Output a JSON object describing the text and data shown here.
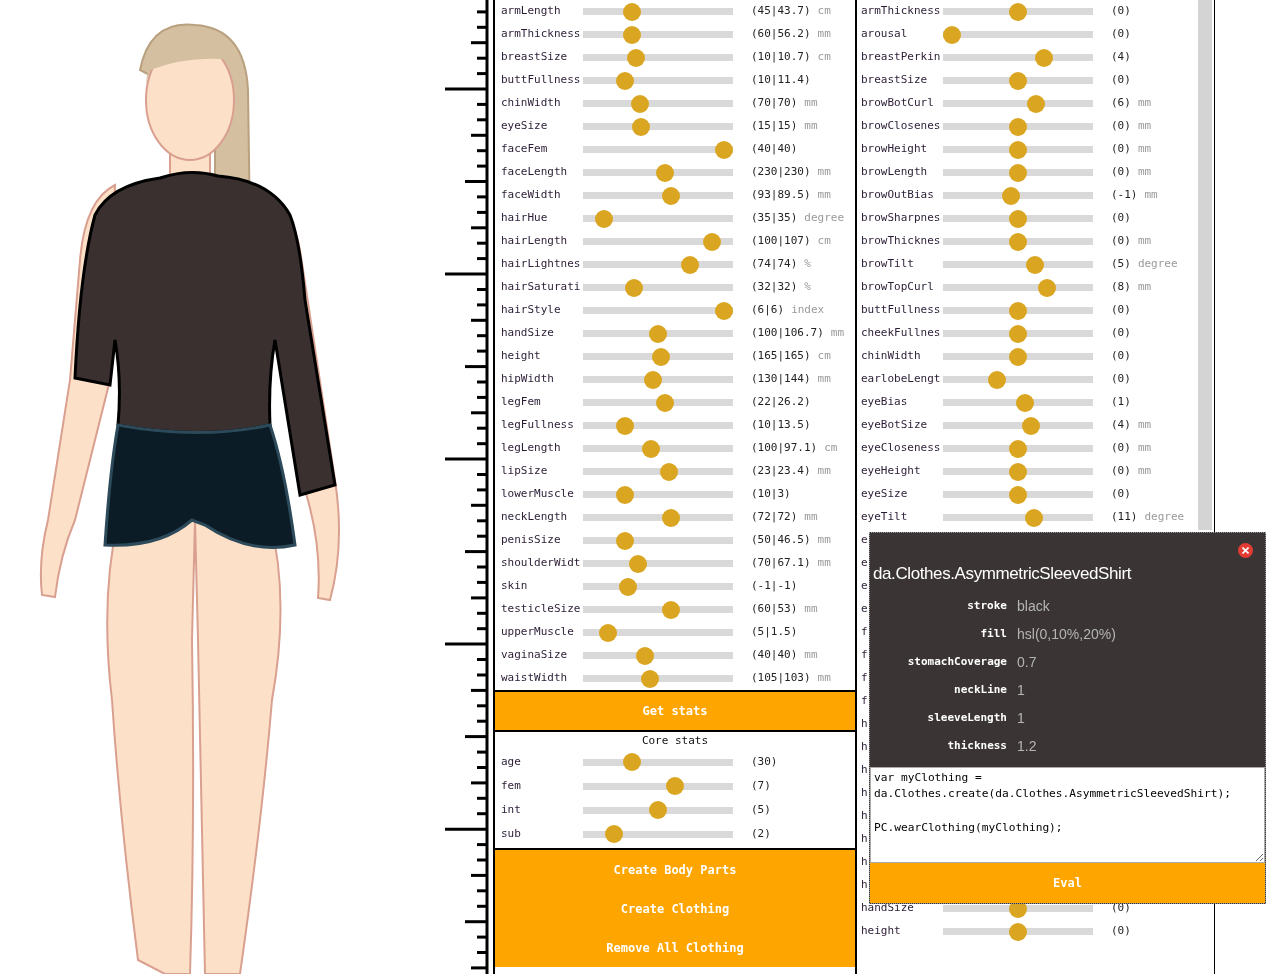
{
  "body_sliders": [
    {
      "label": "armLength",
      "level": 0.3,
      "value": "(45|43.7)",
      "unit": "cm"
    },
    {
      "label": "armThickness",
      "level": 0.3,
      "value": "(60|56.2)",
      "unit": "mm"
    },
    {
      "label": "breastSize",
      "level": 0.33,
      "value": "(10|10.7)",
      "unit": "cm"
    },
    {
      "label": "buttFullness",
      "level": 0.25,
      "value": "(10|11.4)"
    },
    {
      "label": "chinWidth",
      "level": 0.36,
      "value": "(70|70)",
      "unit": "mm"
    },
    {
      "label": "eyeSize",
      "level": 0.37,
      "value": "(15|15)",
      "unit": "mm"
    },
    {
      "label": "faceFem",
      "level": 1.0,
      "value": "(40|40)"
    },
    {
      "label": "faceLength",
      "level": 0.55,
      "value": "(230|230)",
      "unit": "mm"
    },
    {
      "label": "faceWidth",
      "level": 0.6,
      "value": "(93|89.5)",
      "unit": "mm"
    },
    {
      "label": "hairHue",
      "level": 0.09,
      "value": "(35|35)",
      "unit": "degree"
    },
    {
      "label": "hairLength",
      "level": 0.91,
      "value": "(100|107)",
      "unit": "cm"
    },
    {
      "label": "hairLightnes",
      "level": 0.74,
      "value": "(74|74)",
      "unit": "%"
    },
    {
      "label": "hairSaturati",
      "level": 0.32,
      "value": "(32|32)",
      "unit": "%"
    },
    {
      "label": "hairStyle",
      "level": 1.0,
      "value": "(6|6)",
      "unit": "index"
    },
    {
      "label": "handSize",
      "level": 0.5,
      "value": "(100|106.7)",
      "unit": "mm"
    },
    {
      "label": "height",
      "level": 0.52,
      "value": "(165|165)",
      "unit": "cm"
    },
    {
      "label": "hipWidth",
      "level": 0.46,
      "value": "(130|144)",
      "unit": "mm"
    },
    {
      "label": "legFem",
      "level": 0.55,
      "value": "(22|26.2)"
    },
    {
      "label": "legFullness",
      "level": 0.25,
      "value": "(10|13.5)"
    },
    {
      "label": "legLength",
      "level": 0.45,
      "value": "(100|97.1)",
      "unit": "cm"
    },
    {
      "label": "lipSize",
      "level": 0.58,
      "value": "(23|23.4)",
      "unit": "mm"
    },
    {
      "label": "lowerMuscle",
      "level": 0.25,
      "value": "(10|3)"
    },
    {
      "label": "neckLength",
      "level": 0.6,
      "value": "(72|72)",
      "unit": "mm"
    },
    {
      "label": "penisSize",
      "level": 0.25,
      "value": "(50|46.5)",
      "unit": "mm"
    },
    {
      "label": "shoulderWidt",
      "level": 0.35,
      "value": "(70|67.1)",
      "unit": "mm"
    },
    {
      "label": "skin",
      "level": 0.27,
      "value": "(-1|-1)"
    },
    {
      "label": "testicleSize",
      "level": 0.6,
      "value": "(60|53)",
      "unit": "mm"
    },
    {
      "label": "upperMuscle",
      "level": 0.12,
      "value": "(5|1.5)"
    },
    {
      "label": "vaginaSize",
      "level": 0.4,
      "value": "(40|40)",
      "unit": "mm"
    },
    {
      "label": "waistWidth",
      "level": 0.44,
      "value": "(105|103)",
      "unit": "mm"
    }
  ],
  "get_stats_button": "Get stats",
  "core_stats": {
    "title": "Core stats",
    "rows": [
      {
        "label": "age",
        "level": 0.3,
        "value": "(30)"
      },
      {
        "label": "fem",
        "level": 0.63,
        "value": "(7)"
      },
      {
        "label": "int",
        "level": 0.5,
        "value": "(5)"
      },
      {
        "label": "sub",
        "level": 0.17,
        "value": "(2)"
      }
    ]
  },
  "action_buttons": [
    "Create Body Parts",
    "Create Clothing",
    "Remove All Clothing"
  ],
  "face_sliders": [
    {
      "kind": "slider",
      "label": "armThickness",
      "level": 0.5,
      "value": "(0)"
    },
    {
      "kind": "slider",
      "label": "arousal",
      "level": 0.0,
      "value": "(0)"
    },
    {
      "kind": "slider",
      "label": "breastPerkin",
      "level": 0.7,
      "value": "(4)"
    },
    {
      "kind": "slider",
      "label": "breastSize",
      "level": 0.5,
      "value": "(0)"
    },
    {
      "kind": "slider",
      "label": "browBotCurl",
      "level": 0.64,
      "value": "(6)",
      "unit": "mm"
    },
    {
      "kind": "slider",
      "label": "browClosenes",
      "level": 0.5,
      "value": "(0)",
      "unit": "mm"
    },
    {
      "kind": "slider",
      "label": "browHeight",
      "level": 0.5,
      "value": "(0)",
      "unit": "mm"
    },
    {
      "kind": "slider",
      "label": "browLength",
      "level": 0.5,
      "value": "(0)",
      "unit": "mm"
    },
    {
      "kind": "slider",
      "label": "browOutBias",
      "level": 0.45,
      "value": "(-1)",
      "unit": "mm"
    },
    {
      "kind": "slider",
      "label": "browSharpnes",
      "level": 0.5,
      "value": "(0)"
    },
    {
      "kind": "slider",
      "label": "browThicknes",
      "level": 0.5,
      "value": "(0)",
      "unit": "mm"
    },
    {
      "kind": "slider",
      "label": "browTilt",
      "level": 0.63,
      "value": "(5)",
      "unit": "degree"
    },
    {
      "kind": "slider",
      "label": "browTopCurl",
      "level": 0.72,
      "value": "(8)",
      "unit": "mm"
    },
    {
      "kind": "slider",
      "label": "buttFullness",
      "level": 0.5,
      "value": "(0)"
    },
    {
      "kind": "slider",
      "label": "cheekFullnes",
      "level": 0.5,
      "value": "(0)"
    },
    {
      "kind": "slider",
      "label": "chinWidth",
      "level": 0.5,
      "value": "(0)"
    },
    {
      "kind": "slider",
      "label": "earlobeLengt",
      "level": 0.34,
      "value": "(0)"
    },
    {
      "kind": "slider",
      "label": "eyeBias",
      "level": 0.55,
      "value": "(1)"
    },
    {
      "kind": "slider",
      "label": "eyeBotSize",
      "level": 0.6,
      "value": "(4)",
      "unit": "mm"
    },
    {
      "kind": "slider",
      "label": "eyeCloseness",
      "level": 0.5,
      "value": "(0)",
      "unit": "mm"
    },
    {
      "kind": "slider",
      "label": "eyeHeight",
      "level": 0.5,
      "value": "(0)",
      "unit": "mm"
    },
    {
      "kind": "slider",
      "label": "eyeSize",
      "level": 0.5,
      "value": "(0)"
    },
    {
      "kind": "slider",
      "label": "eyeTilt",
      "level": 0.62,
      "value": "(11)",
      "unit": "degree"
    },
    {
      "kind": "covered",
      "label": "e"
    },
    {
      "kind": "covered",
      "label": "e"
    },
    {
      "kind": "covered",
      "label": "e"
    },
    {
      "kind": "covered",
      "label": "e"
    },
    {
      "kind": "covered",
      "label": "f"
    },
    {
      "kind": "covered",
      "label": "f"
    },
    {
      "kind": "covered",
      "label": "f"
    },
    {
      "kind": "covered",
      "label": "f"
    },
    {
      "kind": "covered",
      "label": "h"
    },
    {
      "kind": "covered",
      "label": "h"
    },
    {
      "kind": "covered",
      "label": "h"
    },
    {
      "kind": "covered",
      "label": "h"
    },
    {
      "kind": "covered",
      "label": "h"
    },
    {
      "kind": "covered",
      "label": "h"
    },
    {
      "kind": "covered",
      "label": "h"
    },
    {
      "kind": "covered",
      "label": "h"
    },
    {
      "kind": "slider",
      "label": "handSize",
      "level": 0.5,
      "value": "(0)"
    },
    {
      "kind": "slider",
      "label": "height",
      "level": 0.5,
      "value": "(0)"
    }
  ],
  "clothing_popup": {
    "title": "da.Clothes.AsymmetricSleevedShirt",
    "properties": [
      {
        "label": "stroke",
        "value": "black"
      },
      {
        "label": "fill",
        "value": "hsl(0,10%,20%)"
      },
      {
        "label": "stomachCoverage",
        "value": "0.7"
      },
      {
        "label": "neckLine",
        "value": "1"
      },
      {
        "label": "sleeveLength",
        "value": "1"
      },
      {
        "label": "thickness",
        "value": "1.2"
      }
    ],
    "code": "var myClothing = da.Clothes.create(da.Clothes.AsymmetricSleevedShirt);\n\nPC.wearClothing(myClothing);",
    "eval_button": "Eval"
  }
}
